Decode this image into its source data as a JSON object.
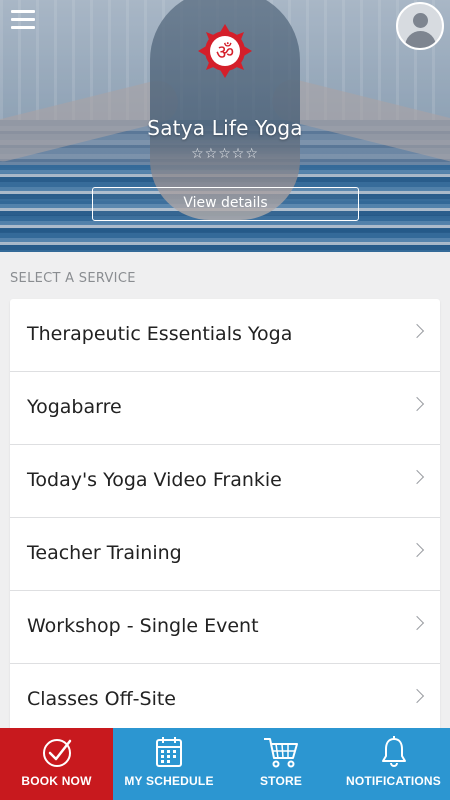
{
  "header": {
    "studio_name": "Satya Life Yoga",
    "rating_stars": "☆☆☆☆☆",
    "view_details_label": "View details"
  },
  "services": {
    "section_label": "SELECT A SERVICE",
    "items": [
      {
        "label": "Therapeutic Essentials Yoga"
      },
      {
        "label": "Yogabarre"
      },
      {
        "label": "Today's Yoga Video Frankie"
      },
      {
        "label": "Teacher Training"
      },
      {
        "label": "Workshop - Single Event"
      },
      {
        "label": "Classes Off-Site"
      }
    ]
  },
  "bottom_nav": {
    "items": [
      {
        "label": "BOOK NOW",
        "icon": "check-circle-icon"
      },
      {
        "label": "MY SCHEDULE",
        "icon": "calendar-icon"
      },
      {
        "label": "STORE",
        "icon": "cart-icon"
      },
      {
        "label": "NOTIFICATIONS",
        "icon": "bell-icon"
      }
    ]
  },
  "colors": {
    "book_now_bg": "#c8191e",
    "nav_bg": "#2c96d1",
    "logo_red": "#d41f2a"
  }
}
